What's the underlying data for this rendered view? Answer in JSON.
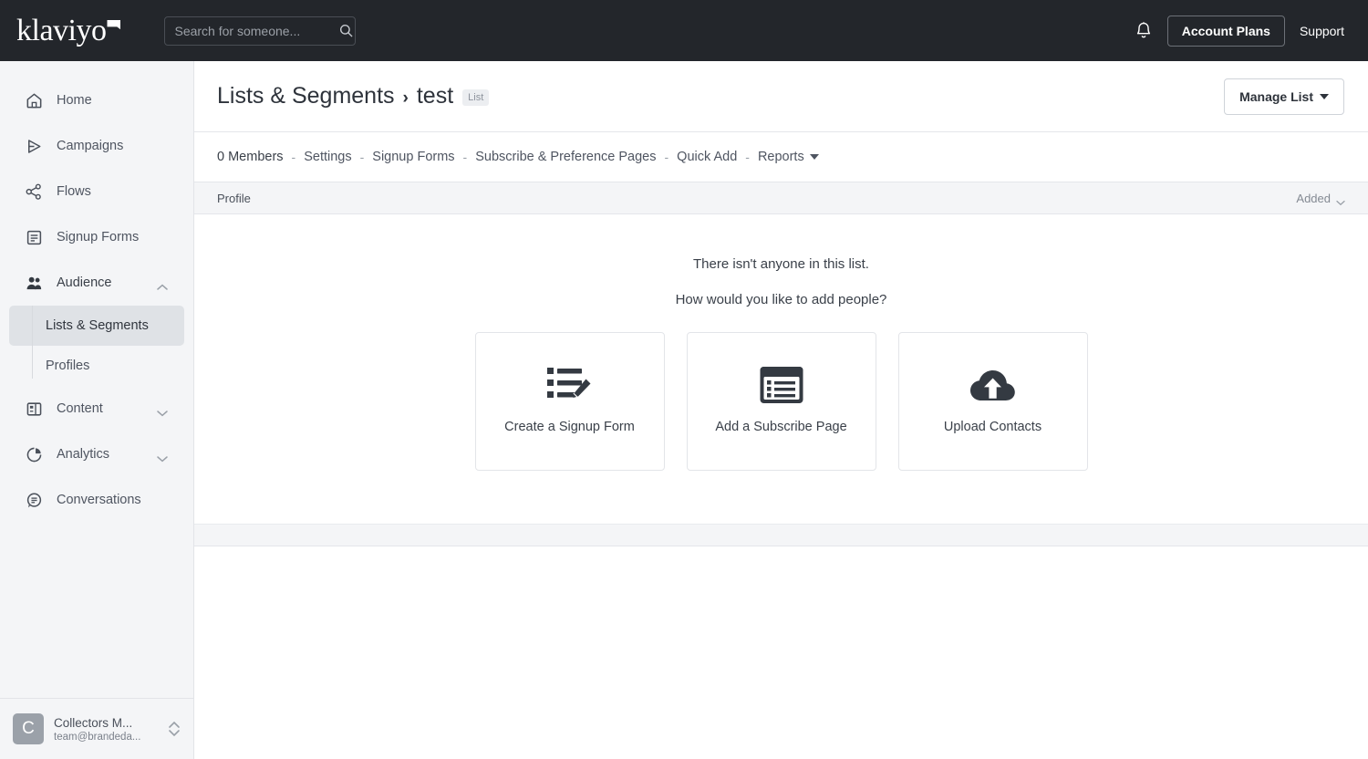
{
  "topbar": {
    "logo_text": "klaviyo",
    "search": {
      "placeholder": "Search for someone...",
      "value": "",
      "icon": "search-icon"
    },
    "bell_icon": "notification-bell-icon",
    "account_plans_label": "Account Plans",
    "support_label": "Support"
  },
  "sidebar": {
    "items": [
      {
        "label": "Home",
        "icon": "home-icon"
      },
      {
        "label": "Campaigns",
        "icon": "campaigns-send-icon"
      },
      {
        "label": "Flows",
        "icon": "flows-share-icon"
      },
      {
        "label": "Signup Forms",
        "icon": "signup-forms-icon"
      },
      {
        "label": "Audience",
        "icon": "audience-people-icon",
        "chevron": "chevron-up-icon"
      },
      {
        "label": "Content",
        "icon": "content-icon",
        "chevron": "chevron-down-icon"
      },
      {
        "label": "Analytics",
        "icon": "analytics-pie-icon",
        "chevron": "chevron-down-icon"
      },
      {
        "label": "Conversations",
        "icon": "conversations-chat-icon"
      }
    ],
    "audience_children": [
      {
        "label": "Lists & Segments",
        "active": true
      },
      {
        "label": "Profiles",
        "active": false
      }
    ],
    "account": {
      "avatar_letter": "C",
      "name": "Collectors M...",
      "email": "team@brandeda...",
      "switch_icon": "up-down-chevron-icon"
    }
  },
  "page": {
    "breadcrumb_parent": "Lists & Segments",
    "breadcrumb_separator": "›",
    "breadcrumb_current": "test",
    "type_badge": "List",
    "manage_button": "Manage List",
    "manage_caret_icon": "caret-down-icon"
  },
  "tabs": [
    {
      "label": "0 Members",
      "active": true
    },
    {
      "label": "Settings",
      "active": false
    },
    {
      "label": "Signup Forms",
      "active": false
    },
    {
      "label": "Subscribe & Preference Pages",
      "active": false
    },
    {
      "label": "Quick Add",
      "active": false
    },
    {
      "label": "Reports",
      "active": false,
      "has_caret": true
    }
  ],
  "tab_separator": "-",
  "table": {
    "columns": [
      {
        "label": "Profile",
        "align": "left"
      },
      {
        "label": "Added",
        "align": "right",
        "sort_icon": "chevron-down-icon"
      }
    ],
    "rows": []
  },
  "empty_state": {
    "headline": "There isn't anyone in this list.",
    "subhead": "How would you like to add people?",
    "options": [
      {
        "label": "Create a Signup Form",
        "icon": "list-edit-icon"
      },
      {
        "label": "Add a Subscribe Page",
        "icon": "browser-window-list-icon"
      },
      {
        "label": "Upload Contacts",
        "icon": "cloud-upload-icon"
      }
    ]
  },
  "colors": {
    "topbar_bg": "#23262b",
    "sidebar_bg": "#f4f5f7",
    "active_item_bg": "#dfe2e6",
    "icon_dark": "#343a42",
    "text_primary": "#3a4049",
    "text_muted": "#848a93"
  }
}
